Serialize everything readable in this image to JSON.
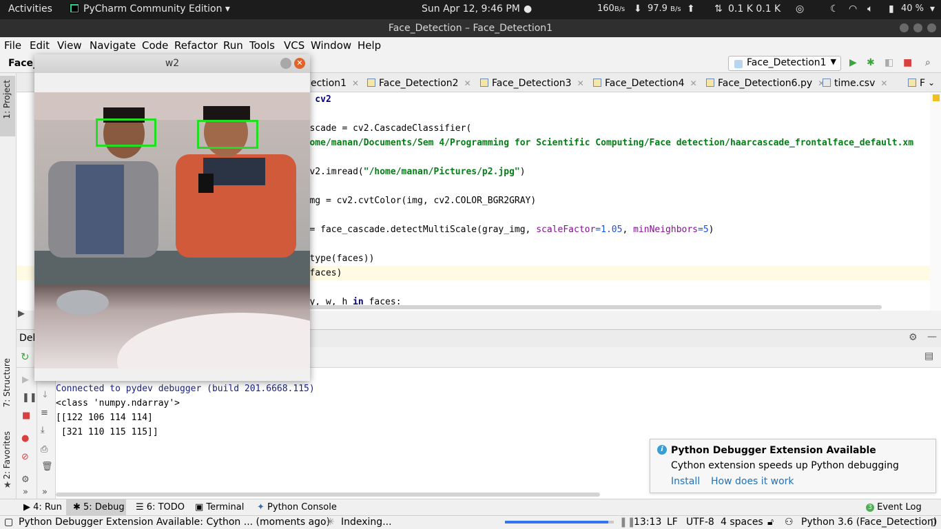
{
  "topbar": {
    "activities": "Activities",
    "app_name": "PyCharm Community Edition",
    "datetime": "Sun Apr 12,  9:46 PM",
    "net_up_rate": "160",
    "net_up_unit": "B/s",
    "net_down_rate": "97.9",
    "net_down_unit": "B/s",
    "net_totals": "0.1 K 0.1 K",
    "battery": "40 %"
  },
  "window": {
    "title": "Face_Detection – Face_Detection1"
  },
  "menu": [
    "File",
    "Edit",
    "View",
    "Navigate",
    "Code",
    "Refactor",
    "Run",
    "Tools",
    "VCS",
    "Window",
    "Help"
  ],
  "nav": {
    "breadcrumb": "Face_",
    "run_config": "Face_Detection1"
  },
  "side_tabs": {
    "project": "1: Project",
    "structure": "7: Structure",
    "favorites": "2: Favorites"
  },
  "editor": {
    "tabs": [
      "ection1",
      "Face_Detection2",
      "Face_Detection3",
      "Face_Detection4",
      "Face_Detection6.py",
      "time.csv",
      "F"
    ],
    "lines": {
      "l1": "ort cv2",
      "l2": "_cascade = cv2.CascadeClassifier(",
      "l3_str": "\"/home/manan/Documents/Sem 4/Programming for Scientific Computing/Face detection/haarcascade_frontalface_default.xm",
      "l4_a": "= cv2.imread(",
      "l4_str": "\"/home/manan/Pictures/p2.jpg\"",
      "l4_b": ")",
      "l5": "y_img = cv2.cvtColor(img, cv2.COLOR_BGR2GRAY)",
      "l6_a": "es = face_cascade.detectMultiScale(gray_img, ",
      "l6_p1": "scaleFactor",
      "l6_v1": "=1.05",
      "l6_c": ", ",
      "l6_p2": "minNeighbors",
      "l6_v2": "=5",
      "l6_d": ")",
      "l7": "nt(type(faces))",
      "l8": "nt(faces)",
      "l9_a": "x, y, w, h ",
      "l9_kw": "in",
      "l9_b": " faces:"
    }
  },
  "debug": {
    "panel_label": "Deb",
    "console": [
      "Connected to pydev debugger (build 201.6668.115)",
      "<class 'numpy.ndarray'>",
      "[[122 106 114 114]",
      " [321 110 115 115]]"
    ]
  },
  "notification": {
    "title": "Python Debugger Extension Available",
    "body": "Cython extension speeds up Python debugging",
    "install": "Install",
    "how": "How does it work"
  },
  "bottom_tabs": {
    "run": "4: Run",
    "debug": "5: Debug",
    "todo": "6: TODO",
    "terminal": "Terminal",
    "console": "Python Console",
    "event_log": "Event Log",
    "event_count": "3"
  },
  "status": {
    "message": "Python Debugger Extension Available: Cython ... (moments ago)",
    "indexing": "Indexing...",
    "indexing_progress": 0.95,
    "position": "13:13",
    "line_sep": "LF",
    "encoding": "UTF-8",
    "indent": "4 spaces",
    "interpreter": "Python 3.6 (Face_Detection)"
  },
  "image_window": {
    "title": "w2"
  },
  "colors": {
    "accent": "#3574f0",
    "face_box": "#22dd22",
    "string": "#067d17",
    "number": "#1750eb",
    "param": "#871094",
    "link": "#2470b3"
  }
}
